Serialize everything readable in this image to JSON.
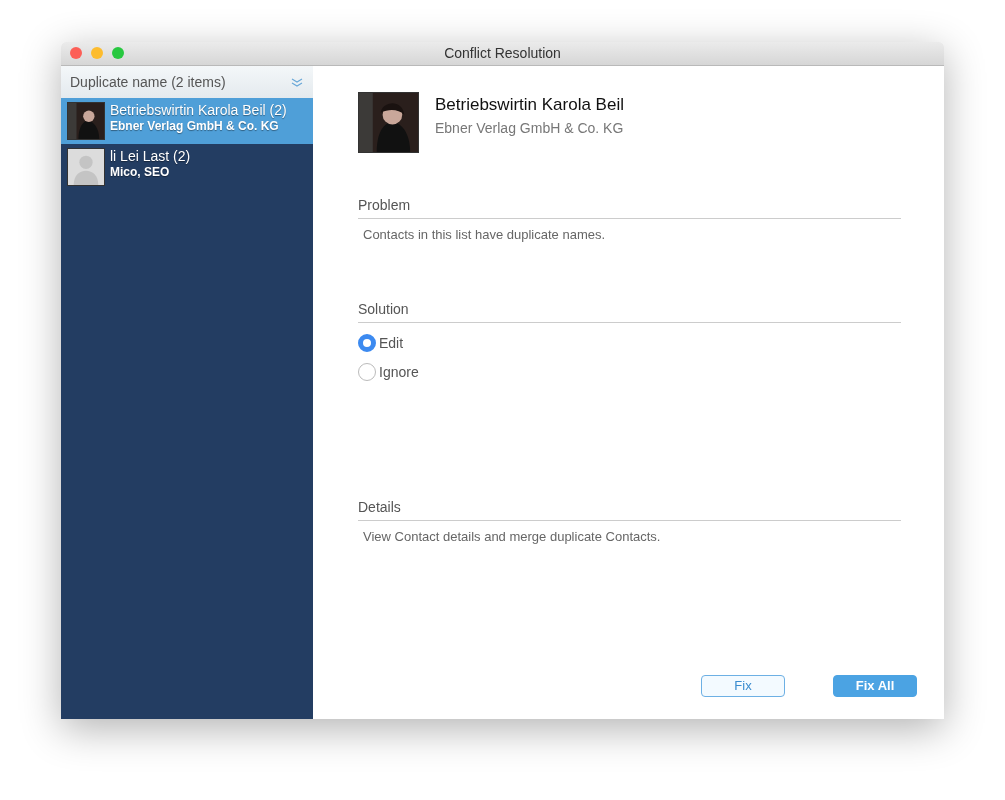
{
  "window": {
    "title": "Conflict Resolution"
  },
  "sidebar": {
    "filter": "Duplicate name (2 items)",
    "items": [
      {
        "name": "Betriebswirtin Karola Beil (2)",
        "subtitle": "Ebner Verlag GmbH & Co. KG",
        "selected": true
      },
      {
        "kind": "placeholder",
        "name": "li Lei Last (2)",
        "subtitle": "Mico, SEO",
        "selected": false
      }
    ]
  },
  "contact": {
    "name": "Betriebswirtin Karola Beil",
    "company": "Ebner Verlag GmbH & Co. KG"
  },
  "problem": {
    "heading": "Problem",
    "text": "Contacts in this list have duplicate names."
  },
  "solution": {
    "heading": "Solution",
    "options": [
      {
        "label": "Edit",
        "selected": true
      },
      {
        "label": "Ignore",
        "selected": false
      }
    ]
  },
  "details": {
    "heading": "Details",
    "text": "View Contact details and merge duplicate Contacts."
  },
  "buttons": [
    {
      "label": "Fix",
      "kind": "secondary"
    },
    {
      "label": "Fix All",
      "kind": "primary"
    }
  ]
}
